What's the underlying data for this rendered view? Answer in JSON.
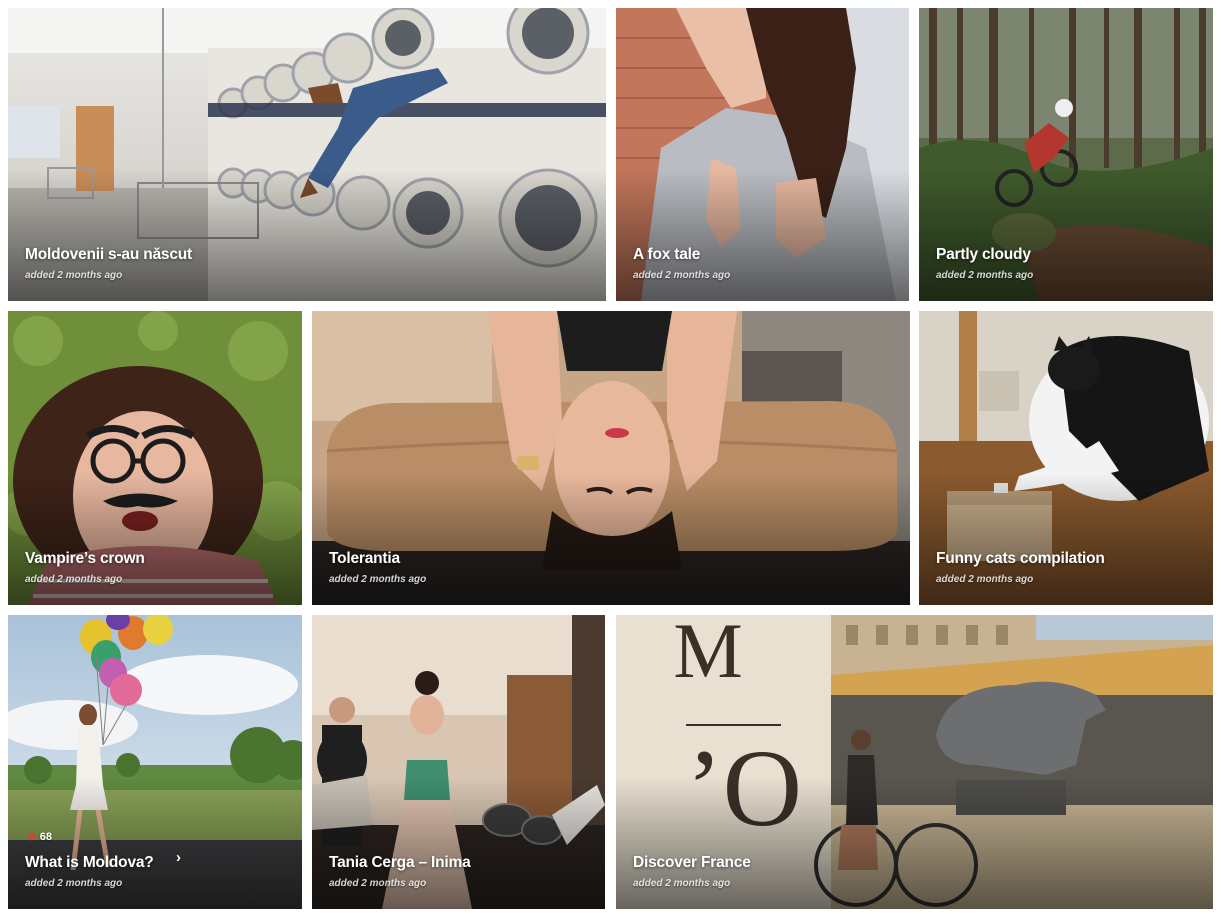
{
  "tiles": [
    {
      "title": "Moldovenii s-au născut",
      "meta": "added 2 months ago"
    },
    {
      "title": "A fox tale",
      "meta": "added 2 months ago"
    },
    {
      "title": "Partly cloudy",
      "meta": "added 2 months ago"
    },
    {
      "title": "Vampire’s crown",
      "meta": "added 2 months ago"
    },
    {
      "title": "Tolerantia",
      "meta": "added 2 months ago"
    },
    {
      "title": "Funny cats compilation",
      "meta": "added 2 months ago"
    },
    {
      "title": "What is Moldova?",
      "meta": "added 2 months ago",
      "likes": "68",
      "like_icon": "heart-icon",
      "arrow_icon": "chevron-right-icon"
    },
    {
      "title": "Tania Cerga – Inima",
      "meta": "added 2 months ago"
    },
    {
      "title": "Discover France",
      "meta": "added 2 months ago"
    }
  ]
}
